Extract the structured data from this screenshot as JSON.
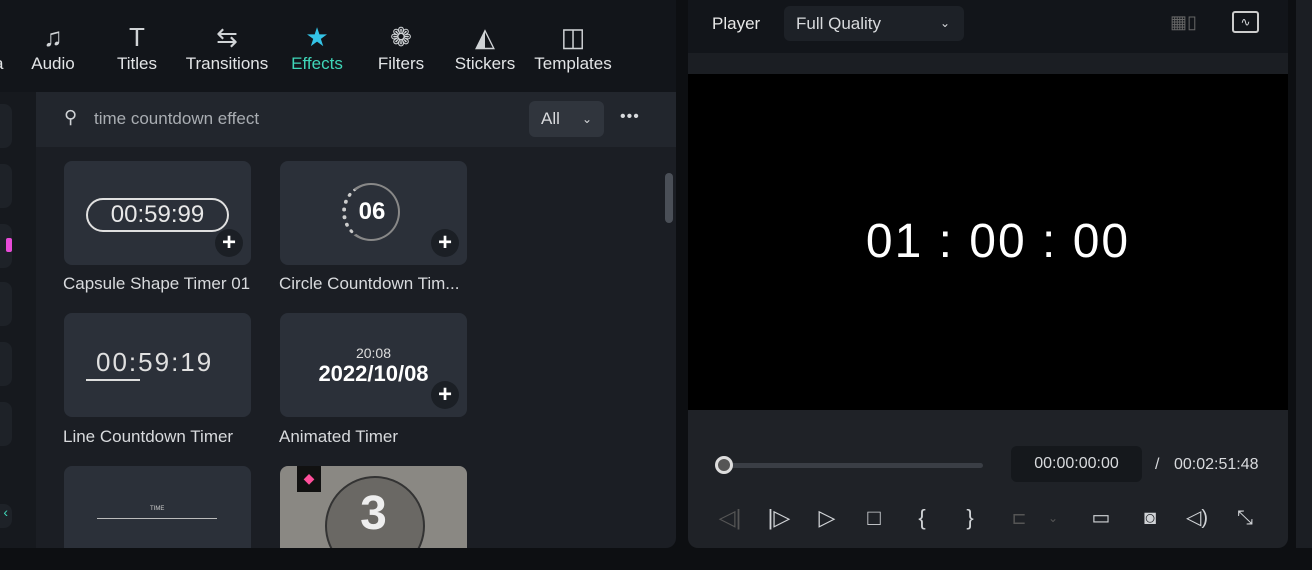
{
  "nav": {
    "partial_label": "a",
    "items": [
      {
        "label": "Audio",
        "icon": "music-note-icon",
        "glyph": "♫"
      },
      {
        "label": "Titles",
        "icon": "text-t-icon",
        "glyph": "T"
      },
      {
        "label": "Transitions",
        "icon": "transitions-icon",
        "glyph": "⇆"
      },
      {
        "label": "Effects",
        "icon": "magic-star-icon",
        "glyph": "★",
        "active": true
      },
      {
        "label": "Filters",
        "icon": "filters-circles-icon",
        "glyph": "❁"
      },
      {
        "label": "Stickers",
        "icon": "sticker-icon",
        "glyph": "◭"
      },
      {
        "label": "Templates",
        "icon": "templates-icon",
        "glyph": "◫"
      }
    ]
  },
  "search": {
    "value": "time countdown effect",
    "filter": "All",
    "more": "•••"
  },
  "effects": [
    {
      "name": "Capsule Shape Timer 01",
      "preview": "00:59:99"
    },
    {
      "name": "Circle Countdown Tim...",
      "preview": "06"
    },
    {
      "name": "Line Countdown Timer",
      "preview": "00:59:19"
    },
    {
      "name": "Animated Timer",
      "preview_time": "20:08",
      "preview_date": "2022/10/08"
    },
    {
      "name": "",
      "preview": "TIME"
    },
    {
      "name": "",
      "preview": "3",
      "premium": true
    }
  ],
  "player": {
    "label": "Player",
    "quality": "Full Quality",
    "display_time": "01 : 00 : 00",
    "current_time": "00:00:00:00",
    "separator": "/",
    "total_time": "00:02:51:48",
    "progress": 0
  },
  "colors": {
    "accent": "#3fd6b8",
    "premium": "#ff4f9a"
  }
}
